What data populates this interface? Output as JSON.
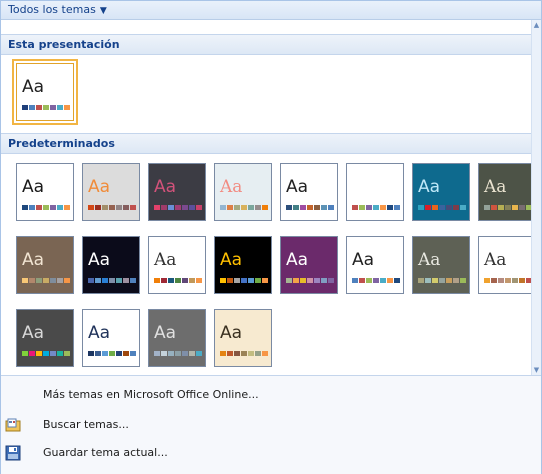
{
  "header": {
    "title": "Todos los temas",
    "dropdown_icon": "dropdown-arrow-icon"
  },
  "sections": {
    "current": {
      "label": "Esta presentación"
    },
    "builtin": {
      "label": "Predeterminados"
    }
  },
  "thumb_text": "Aa",
  "themes": {
    "current": [
      {
        "bg": "#ffffff",
        "text": "#222222",
        "serif": false,
        "sw": [
          "#1f3f7a",
          "#4f81bd",
          "#c0504d",
          "#9bbb59",
          "#8064a2",
          "#4bacc6",
          "#f79646"
        ]
      }
    ],
    "builtin": [
      {
        "bg": "#ffffff",
        "text": "#1a1a1a",
        "serif": false,
        "sw": [
          "#1f497d",
          "#4f81bd",
          "#c0504d",
          "#9bbb59",
          "#8064a2",
          "#4bacc6",
          "#f79646"
        ]
      },
      {
        "bg": "#dcdcdc",
        "text": "#f08c3a",
        "serif": false,
        "sw": [
          "#d34817",
          "#9b2d1f",
          "#a28e6a",
          "#956251",
          "#918485",
          "#855d5d",
          "#c0504d"
        ]
      },
      {
        "bg": "#3c3c44",
        "text": "#d2527a",
        "serif": false,
        "sw": [
          "#e2416b",
          "#9f3b6a",
          "#6a8fd6",
          "#a23d76",
          "#7b4a8f",
          "#5a4f9a",
          "#c9406a"
        ]
      },
      {
        "bg": "#e6eef2",
        "text": "#f28b82",
        "serif": true,
        "sw": [
          "#94b6d2",
          "#dd8047",
          "#a5ab81",
          "#d8b25c",
          "#7ba79d",
          "#968c8c",
          "#f07f09"
        ]
      },
      {
        "bg": "#ffffff",
        "text": "#222222",
        "serif": false,
        "sw": [
          "#2d4f7c",
          "#438086",
          "#a04da3",
          "#c4652d",
          "#8b5d3d",
          "#5c92b5",
          "#4f81bd"
        ]
      },
      {
        "bg": "#ffffff",
        "text": "#ffffff",
        "serif": false,
        "sw": [
          "#c0504d",
          "#9bbb59",
          "#8064a2",
          "#4bacc6",
          "#f79646",
          "#1f497d",
          "#4f81bd"
        ]
      },
      {
        "bg": "#0e6a8e",
        "text": "#bfe8f8",
        "serif": false,
        "sw": [
          "#2da2bf",
          "#da1f28",
          "#eb641b",
          "#39639d",
          "#474b78",
          "#7d3c4a",
          "#4bacc6"
        ]
      },
      {
        "bg": "#4d5347",
        "text": "#e9e2cf",
        "serif": true,
        "sw": [
          "#93a299",
          "#cf543f",
          "#b5ae53",
          "#848058",
          "#e8b54d",
          "#786c71",
          "#9bbb59"
        ]
      },
      {
        "bg": "#7a6553",
        "text": "#f1e4d2",
        "serif": false,
        "sw": [
          "#f8c776",
          "#b2876c",
          "#8d9e7b",
          "#c9ab64",
          "#7f8d9c",
          "#a4a1a3",
          "#f79646"
        ]
      },
      {
        "bg": "#0b0b1a",
        "text": "#ffffff",
        "serif": false,
        "sw": [
          "#4a66ac",
          "#629dd1",
          "#297fd5",
          "#7f8fa9",
          "#5aa2ae",
          "#9d90a0",
          "#4f81bd"
        ]
      },
      {
        "bg": "#ffffff",
        "text": "#333333",
        "serif": true,
        "sw": [
          "#f07f09",
          "#9f2936",
          "#1b587c",
          "#4e8542",
          "#604878",
          "#c19859",
          "#f79646"
        ]
      },
      {
        "bg": "#000000",
        "text": "#ffc000",
        "serif": false,
        "sw": [
          "#ffc000",
          "#c55a11",
          "#a5a5a5",
          "#4472c4",
          "#5b9bd5",
          "#70ad47",
          "#f79646"
        ]
      },
      {
        "bg": "#6b2a6b",
        "text": "#ffffff",
        "serif": false,
        "sw": [
          "#a5b592",
          "#f3a447",
          "#e7bc29",
          "#d092a7",
          "#9c85c0",
          "#809ec2",
          "#8064a2"
        ]
      },
      {
        "bg": "#ffffff",
        "text": "#222222",
        "serif": false,
        "sw": [
          "#4f81bd",
          "#c0504d",
          "#9bbb59",
          "#8064a2",
          "#4bacc6",
          "#f79646",
          "#1f497d"
        ]
      },
      {
        "bg": "#5e6155",
        "text": "#e8e8e0",
        "serif": true,
        "sw": [
          "#a9a57c",
          "#9cbebd",
          "#d2cb6c",
          "#95a39d",
          "#c89f5d",
          "#b1a089",
          "#9bbb59"
        ]
      },
      {
        "bg": "#ffffff",
        "text": "#333333",
        "serif": true,
        "sw": [
          "#f0a22e",
          "#a5644e",
          "#b58b80",
          "#c3986d",
          "#a19574",
          "#c17529",
          "#c0504d"
        ]
      },
      {
        "bg": "#4a4a4a",
        "text": "#d8d8d8",
        "serif": false,
        "sw": [
          "#7fd13b",
          "#ea157a",
          "#feb80a",
          "#00addc",
          "#738ac8",
          "#1ab39f",
          "#9bbb59"
        ]
      },
      {
        "bg": "#ffffff",
        "text": "#20335a",
        "serif": false,
        "sw": [
          "#1d3661",
          "#3b5e91",
          "#5b9bd5",
          "#70ad47",
          "#264478",
          "#9e480e",
          "#4f81bd"
        ]
      },
      {
        "bg": "#6d6d6d",
        "text": "#e0e0e0",
        "serif": false,
        "sw": [
          "#a2b2c8",
          "#c5d2db",
          "#97b1c0",
          "#8ca0a7",
          "#7f8fa9",
          "#b1b5ab",
          "#4bacc6"
        ]
      },
      {
        "bg": "#f7ead0",
        "text": "#3a3020",
        "serif": false,
        "sw": [
          "#e48312",
          "#bd582c",
          "#865640",
          "#9b8357",
          "#c2bc80",
          "#94a088",
          "#f79646"
        ]
      }
    ]
  },
  "menu": {
    "online": "Más temas en Microsoft Office Online...",
    "browse": "Buscar temas...",
    "save": "Guardar tema actual..."
  }
}
